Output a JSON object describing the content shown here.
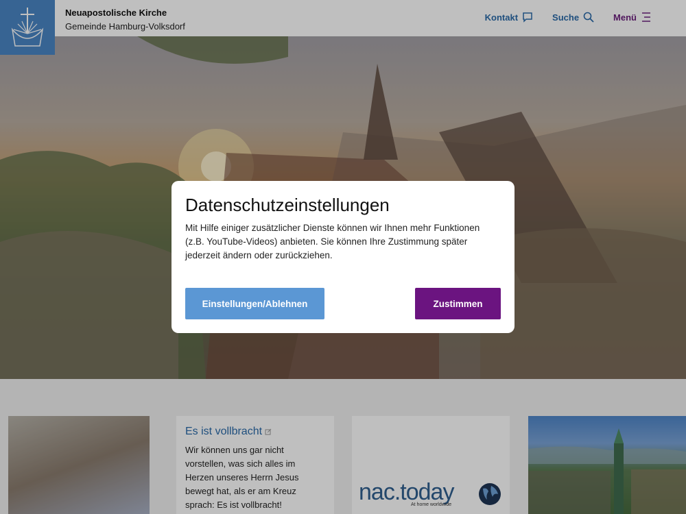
{
  "header": {
    "church_name": "Neuapostolische Kirche",
    "congregation": "Gemeinde Hamburg-Volksdorf",
    "nav": {
      "contact": "Kontakt",
      "search": "Suche",
      "menu": "Menü"
    }
  },
  "cards": {
    "text_card": {
      "title": "Es ist vollbracht",
      "body": "Wir können uns gar nicht vorstellen, was sich alles im Herzen unseres Herrn Jesus bewegt hat, als er am Kreuz sprach: Es ist vollbracht!"
    },
    "logo_card": {
      "logo_text": "nac.today",
      "tagline": "At home worldwide"
    }
  },
  "dialog": {
    "title": "Datenschutzeinstellungen",
    "text": "Mit Hilfe einiger zusätzlicher Dienste können wir Ihnen mehr Funktionen (z.B. YouTube-Videos) anbieten. Sie können Ihre Zustimmung später jederzeit ändern oder zurückziehen.",
    "settings_button": "Einstellungen/Ablehnen",
    "accept_button": "Zustimmen"
  },
  "colors": {
    "brand_blue": "#4a86c5",
    "accent_purple": "#6b1480",
    "settings_button": "#5b97d4"
  },
  "icons": [
    "nak-logo-icon",
    "chat-bubble-icon",
    "search-icon",
    "menu-icon",
    "external-link-icon",
    "globe-icon"
  ]
}
